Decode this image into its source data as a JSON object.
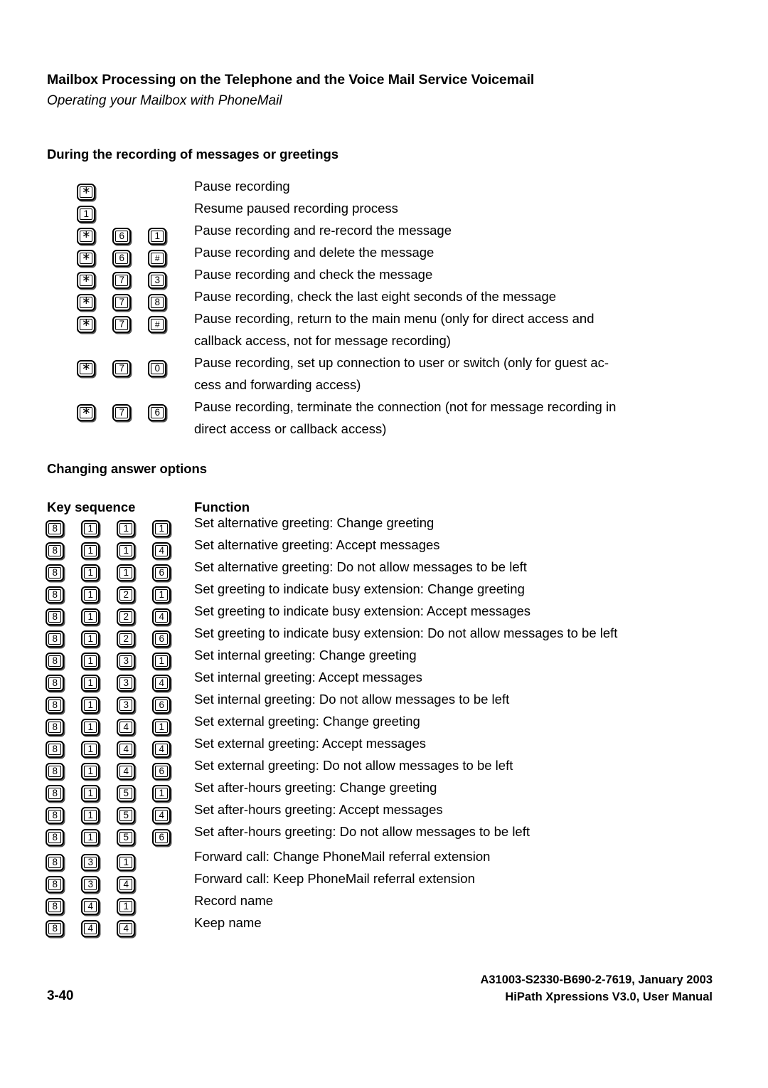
{
  "header": {
    "title": "Mailbox Processing on the Telephone and the Voice Mail Service Voicemail",
    "subtitle": "Operating your Mailbox with PhoneMail"
  },
  "section1": {
    "heading": "During the recording of messages or greetings",
    "rows": [
      {
        "keys": [
          "*"
        ],
        "text": "Pause recording"
      },
      {
        "keys": [
          "1"
        ],
        "text": "Resume paused recording process"
      },
      {
        "keys": [
          "*",
          "6",
          "1"
        ],
        "text": "Pause recording and re-record the message"
      },
      {
        "keys": [
          "*",
          "6",
          "#"
        ],
        "text": "Pause recording and delete the message"
      },
      {
        "keys": [
          "*",
          "7",
          "3"
        ],
        "text": "Pause recording and check the message"
      },
      {
        "keys": [
          "*",
          "7",
          "8"
        ],
        "text": "Pause recording, check the last eight seconds of the message"
      },
      {
        "keys": [
          "*",
          "7",
          "#"
        ],
        "text": "Pause recording, return to the main menu (only for direct access and\ncallback access, not for message recording)"
      },
      {
        "keys": [
          "*",
          "7",
          "0"
        ],
        "text": "Pause recording, set up connection to user or switch (only for guest ac-\ncess and forwarding access)"
      },
      {
        "keys": [
          "*",
          "7",
          "6"
        ],
        "text": "Pause recording, terminate the connection (not for message recording in\ndirect access or callback access)"
      }
    ]
  },
  "section2": {
    "heading": "Changing answer options",
    "columns": {
      "keys": "Key sequence",
      "function": "Function"
    },
    "rows": [
      {
        "keys": [
          "8",
          "1",
          "1",
          "1"
        ],
        "text": "Set alternative greeting: Change greeting"
      },
      {
        "keys": [
          "8",
          "1",
          "1",
          "4"
        ],
        "text": "Set alternative greeting: Accept messages"
      },
      {
        "keys": [
          "8",
          "1",
          "1",
          "6"
        ],
        "text": "Set alternative greeting: Do not allow messages to be left"
      },
      {
        "keys": [
          "8",
          "1",
          "2",
          "1"
        ],
        "text": "Set greeting to indicate busy extension: Change greeting"
      },
      {
        "keys": [
          "8",
          "1",
          "2",
          "4"
        ],
        "text": "Set greeting to indicate busy extension: Accept messages"
      },
      {
        "keys": [
          "8",
          "1",
          "2",
          "6"
        ],
        "text": "Set greeting to indicate busy extension: Do not allow messages to be left"
      },
      {
        "keys": [
          "8",
          "1",
          "3",
          "1"
        ],
        "text": "Set internal greeting: Change greeting"
      },
      {
        "keys": [
          "8",
          "1",
          "3",
          "4"
        ],
        "text": "Set internal greeting: Accept messages"
      },
      {
        "keys": [
          "8",
          "1",
          "3",
          "6"
        ],
        "text": "Set internal greeting: Do not allow messages to be left"
      },
      {
        "keys": [
          "8",
          "1",
          "4",
          "1"
        ],
        "text": "Set external greeting: Change greeting"
      },
      {
        "keys": [
          "8",
          "1",
          "4",
          "4"
        ],
        "text": "Set external greeting: Accept messages"
      },
      {
        "keys": [
          "8",
          "1",
          "4",
          "6"
        ],
        "text": "Set external greeting: Do not allow messages to be left"
      },
      {
        "keys": [
          "8",
          "1",
          "5",
          "1"
        ],
        "text": "Set after-hours greeting: Change greeting"
      },
      {
        "keys": [
          "8",
          "1",
          "5",
          "4"
        ],
        "text": "Set after-hours greeting: Accept messages"
      },
      {
        "keys": [
          "8",
          "1",
          "5",
          "6"
        ],
        "text": "Set after-hours greeting: Do not allow messages to be left"
      },
      {
        "keys": [
          "8",
          "3",
          "1"
        ],
        "text": "Forward call: Change PhoneMail referral extension"
      },
      {
        "keys": [
          "8",
          "3",
          "4"
        ],
        "text": "Forward call: Keep PhoneMail referral extension"
      },
      {
        "keys": [
          "8",
          "4",
          "1"
        ],
        "text": "Record name"
      },
      {
        "keys": [
          "8",
          "4",
          "4"
        ],
        "text": "Keep name"
      }
    ]
  },
  "footer": {
    "page_number": "3-40",
    "doc_id": "A31003-S2330-B690-2-7619, January 2003",
    "manual": "HiPath Xpressions V3.0, User Manual"
  }
}
